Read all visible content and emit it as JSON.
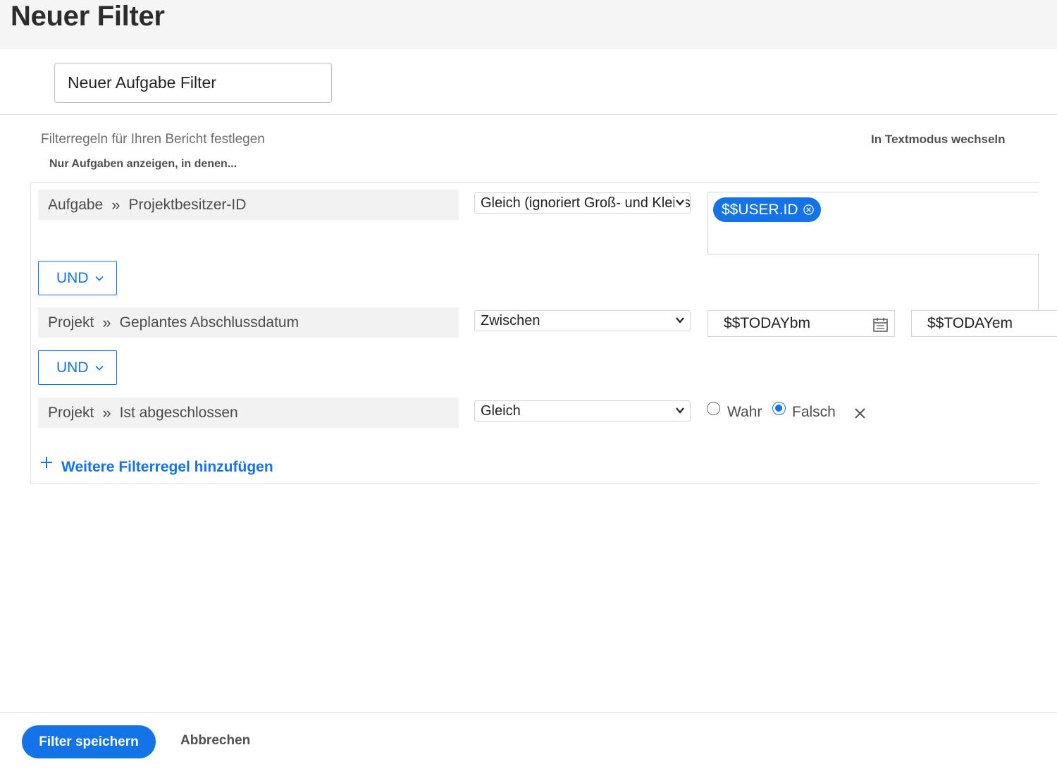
{
  "header": {
    "title": "Neuer Filter"
  },
  "filter_name": {
    "value": "Neuer Aufgabe Filter"
  },
  "instructions": {
    "main": "Filterregeln für Ihren Bericht festlegen",
    "sub": "Nur Aufgaben anzeigen, in denen...",
    "text_mode_link": "In Textmodus wechseln"
  },
  "rules": [
    {
      "object": "Aufgabe",
      "field": "Projektbesitzer-ID",
      "operator": "Gleich (ignoriert Groß- und Kleinschreibung)",
      "value_token": "$$USER.ID"
    },
    {
      "object": "Projekt",
      "field": "Geplantes Abschlussdatum",
      "operator": "Zwischen",
      "value_from": "$$TODAYbm",
      "value_to": "$$TODAYem"
    },
    {
      "object": "Projekt",
      "field": "Ist abgeschlossen",
      "operator": "Gleich",
      "radio_true_label": "Wahr",
      "radio_false_label": "Falsch",
      "selected": "Falsch"
    }
  ],
  "connectors": [
    "UND",
    "UND"
  ],
  "add_rule_label": "Weitere Filterregel hinzufügen",
  "footer": {
    "save_label": "Filter speichern",
    "cancel_label": "Abbrechen"
  },
  "icons": {
    "breadcrumb_separator": "double-chevron-right-icon",
    "select_arrow": "chevron-down-icon",
    "token_remove": "circle-close-icon",
    "date_picker": "calendar-icon",
    "remove_rule": "close-icon",
    "add_rule": "plus-icon"
  },
  "colors": {
    "accent": "#1473e6",
    "header_bg": "#f5f5f5",
    "pill_bg": "#f2f2f2"
  }
}
